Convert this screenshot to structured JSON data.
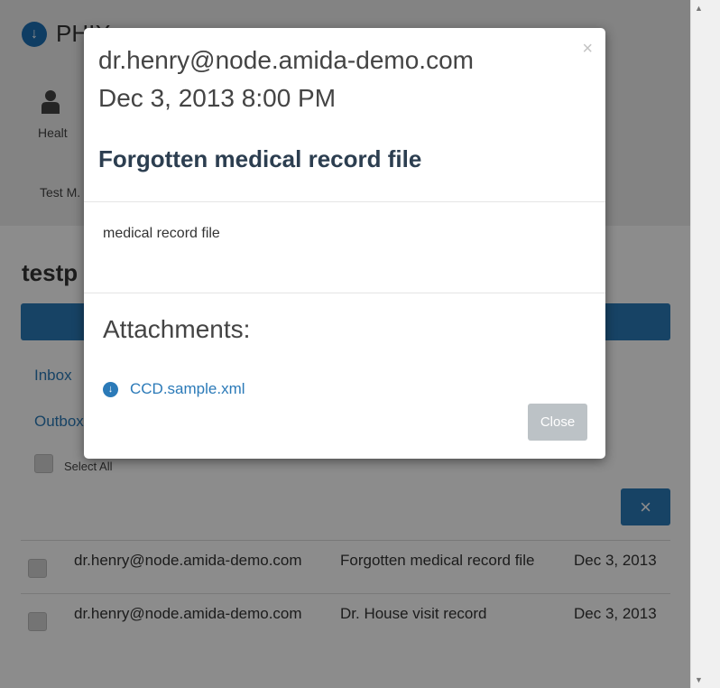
{
  "app": {
    "brand": "PHIX",
    "nav_label": "Healt",
    "user_label": "Test M.",
    "page_title": "testp",
    "inbox_label": "Inbox",
    "outbox_label": "Outbox",
    "select_all_label": "Select All",
    "delete_icon": "×"
  },
  "messages": [
    {
      "from": "dr.henry@node.amida-demo.com",
      "subject": "Forgotten medical record file",
      "date": "Dec 3, 2013"
    },
    {
      "from": "dr.henry@node.amida-demo.com",
      "subject": "Dr. House visit record",
      "date": "Dec 3, 2013"
    }
  ],
  "modal": {
    "close_x": "×",
    "from": "dr.henry@node.amida-demo.com",
    "date": "Dec 3, 2013 8:00 PM",
    "subject": "Forgotten medical record file",
    "body": "medical record file",
    "attachments_title": "Attachments:",
    "attachment": "CCD.sample.xml",
    "close_label": "Close"
  },
  "colors": {
    "accent": "#2b7ab8",
    "close_button": "#bcc2c6"
  }
}
